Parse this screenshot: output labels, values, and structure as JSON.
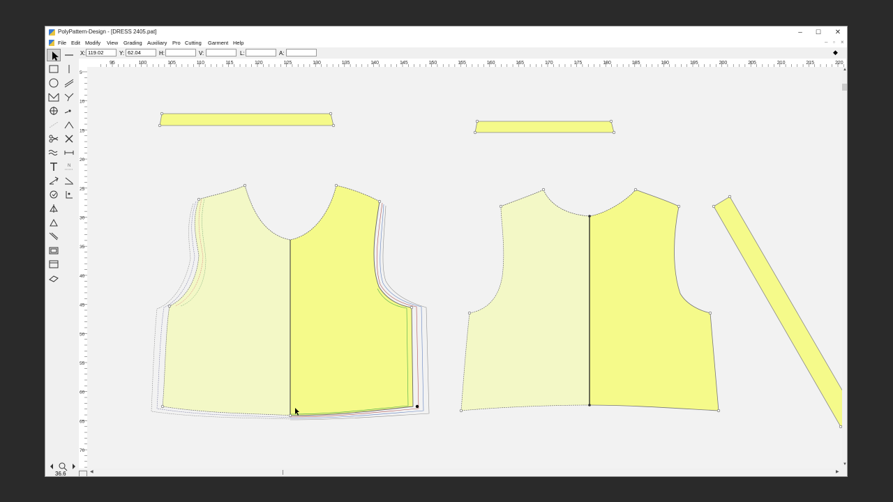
{
  "window": {
    "title": "PolyPattern-Design - [DRESS 2405.pat]",
    "controls": {
      "minimize": "–",
      "maximize": "☐",
      "close": "✕"
    }
  },
  "menu": [
    "File",
    "Edit",
    "Modify",
    "View",
    "Grading",
    "Auxiliary",
    "Pro",
    "Cutting",
    "Garment",
    "Help"
  ],
  "coords": {
    "x_label": "X:",
    "x_value": "119.02",
    "y_label": "Y:",
    "y_value": "62.04",
    "h_label": "H:",
    "h_value": "",
    "v_label": "V:",
    "v_value": "",
    "l_label": "L:",
    "l_value": "",
    "a_label": "A:",
    "a_value": ""
  },
  "ruler": {
    "h_labels": [
      "95",
      "100",
      "105",
      "110",
      "115",
      "120",
      "125",
      "130",
      "135",
      "140",
      "145",
      "150",
      "155",
      "160",
      "165",
      "170",
      "175",
      "180",
      "185",
      "190",
      "195",
      "200",
      "205",
      "210",
      "215",
      "220"
    ],
    "v_labels": [
      "5",
      "10",
      "15",
      "20",
      "25",
      "30",
      "35",
      "40",
      "45",
      "50",
      "55",
      "60",
      "65",
      "70"
    ]
  },
  "status": {
    "zoom": "36.6"
  },
  "colors": {
    "piece_fill": "#f5fa8a",
    "piece_fill_light": "#f3f8c6",
    "outline": "#888888"
  },
  "tools": [
    "arrow-icon",
    "line-icon",
    "rectangle-icon",
    "vertical-line-icon",
    "circle-icon",
    "parallel-icon",
    "dart-icon",
    "angle-icon",
    "point-icon",
    "dot-icon",
    "dashed-line-icon",
    "corner-icon",
    "scissors-icon",
    "cross-icon",
    "wave-icon",
    "measure-icon",
    "text-icon",
    "notch-icon",
    "grade-icon",
    "measure-points-icon",
    "rotate-icon",
    "align-icon",
    "mirror-icon",
    "fold-icon",
    "seam-allowance-icon",
    "ruler-icon",
    "piece-icon",
    "layer-icon",
    "marker-icon"
  ]
}
